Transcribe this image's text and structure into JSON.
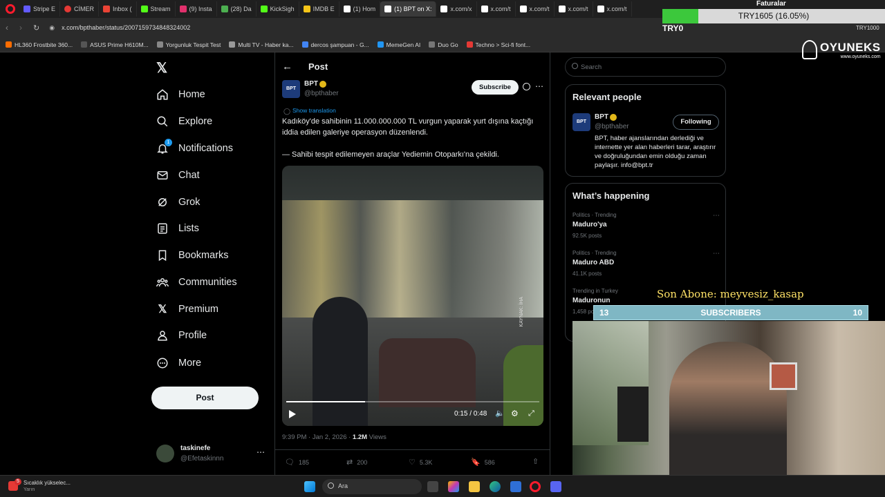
{
  "browser": {
    "tabs": [
      "Stripe E",
      "CİMER",
      "Inbox (",
      "Stream",
      "(9) Insta",
      "(28) Da",
      "KickSigh",
      "IMDB E",
      "(1) Hom",
      "(1) BPT on X:",
      "x.com/x",
      "x.com/t",
      "x.com/t",
      "x.com/t",
      "x.com/t",
      "x.com/t",
      "x.com/t"
    ],
    "address": "x.com/bpthaber/status/2007159734848324002",
    "bookmarks": [
      "HL360 Frostbite 360...",
      "ASUS Prime H610M...",
      "Yorgunluk Tespit Test",
      "Multi TV - Haber ka...",
      "dercos şampuan - G...",
      "MemeGen AI",
      "Duo Go",
      "Techno > Sci-fi font..."
    ],
    "colors": {
      "chrome": "#1f1f1f",
      "accent": "#1d9bf0"
    }
  },
  "overlay": {
    "faturalar_label": "Faturalar",
    "currency_label": "TRY1605 (16.05%)",
    "currency_short": "TRY0",
    "currency_right": "TRY1000",
    "progress_percent": 16.05,
    "brand": "OYUNEKS",
    "brand_url": "www.oyuneks.com",
    "last_subscriber": "Son Abone: meyvesiz_kasap",
    "sub_left": "13",
    "sub_title": "SUBSCRIBERS",
    "sub_right": "10"
  },
  "sidebar": {
    "items": [
      {
        "label": "Home",
        "icon": "home-icon"
      },
      {
        "label": "Explore",
        "icon": "search-icon"
      },
      {
        "label": "Notifications",
        "icon": "bell-icon",
        "badge": "1"
      },
      {
        "label": "Chat",
        "icon": "mail-icon"
      },
      {
        "label": "Grok",
        "icon": "grok-icon"
      },
      {
        "label": "Lists",
        "icon": "list-icon"
      },
      {
        "label": "Bookmarks",
        "icon": "bookmark-icon"
      },
      {
        "label": "Communities",
        "icon": "communities-icon"
      },
      {
        "label": "Premium",
        "icon": "x-logo-icon"
      },
      {
        "label": "Profile",
        "icon": "person-icon"
      },
      {
        "label": "More",
        "icon": "more-circle-icon"
      }
    ],
    "post_button": "Post",
    "account": {
      "name": "taskinefe",
      "handle": "@Efetaskinnn"
    }
  },
  "post": {
    "header_title": "Post",
    "author_name": "BPT",
    "author_handle": "@bpthaber",
    "avatar_text": "BPT",
    "subscribe_label": "Subscribe",
    "show_translation": "Show translation",
    "text_line1": "Kadıköy'de sahibinin 11.000.000.000 TL vurgun yaparak yurt dışına kaçtığı iddia edilen galeriye operasyon düzenlendi.",
    "text_line2": "— Sahibi tespit edilemeyen araçlar Yediemin Otoparkı'na çekildi.",
    "video": {
      "time": "0:15 / 0:48",
      "progress": 0.3125,
      "watermark": "KAYNAK: İHA"
    },
    "timestamp": "9:39 PM · Jan 2, 2026 · ",
    "views_count": "1.2M",
    "views_label": " Views",
    "stats": {
      "replies": "185",
      "reposts": "200",
      "likes": "5.3K",
      "bookmarks": "586"
    }
  },
  "right": {
    "search_placeholder": "Search",
    "relevant_title": "Relevant people",
    "person": {
      "name": "BPT",
      "handle": "@bpthaber",
      "follow_label": "Following",
      "bio": "BPT, haber ajanslarından derlediği ve internette yer alan haberleri tarar, araştırır ve doğruluğundan emin olduğu zaman paylaşır. info@bpt.tr"
    },
    "happening_title": "What’s happening",
    "trends": [
      {
        "category": "Politics · Trending",
        "title": "Maduro'ya",
        "posts": "92.5K posts"
      },
      {
        "category": "Politics · Trending",
        "title": "Maduro ABD",
        "posts": "41.1K posts"
      },
      {
        "category": "Trending in Turkey",
        "title": "Maduronun",
        "posts": "1,458 posts"
      }
    ]
  },
  "taskbar": {
    "weather_title": "Sıcaklık yükselec...",
    "weather_sub": "Yarın",
    "weather_badge": "5",
    "search_label": "Ara"
  }
}
